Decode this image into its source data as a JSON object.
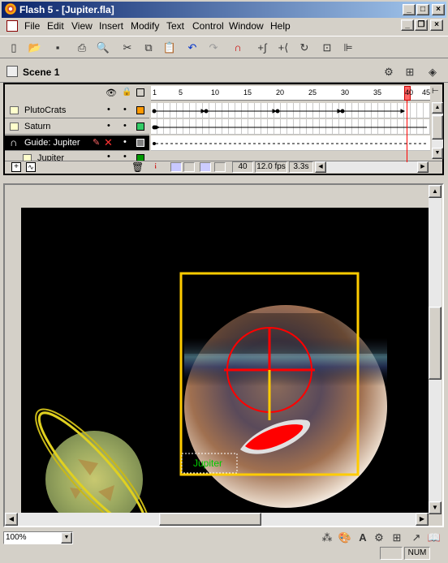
{
  "window": {
    "title": "Flash 5 - [Jupiter.fla]"
  },
  "menu": [
    "File",
    "Edit",
    "View",
    "Insert",
    "Modify",
    "Text",
    "Control",
    "Window",
    "Help"
  ],
  "scene": {
    "label": "Scene 1"
  },
  "timeline": {
    "ruler": [
      "1",
      "5",
      "10",
      "15",
      "20",
      "25",
      "30",
      "35",
      "40",
      "45"
    ],
    "layers": [
      {
        "name": "PlutoCrats",
        "color": "#ff9900"
      },
      {
        "name": "Saturn",
        "color": "#33cc66"
      },
      {
        "name": "Guide: Jupiter",
        "color": "#808080"
      },
      {
        "name": "Jupiter",
        "color": "#009900"
      }
    ],
    "current_frame": "40",
    "fps": "12.0 fps",
    "elapsed": "3.3s"
  },
  "stage": {
    "label_jupiter": "Jupiter"
  },
  "status": {
    "zoom": "100%",
    "num": "NUM"
  },
  "colors": {
    "title_start": "#0a246a",
    "title_end": "#a6caf0",
    "stage_bg": "#000000",
    "guide": "#ffcc00",
    "crosshair": "#ff0000",
    "label": "#00cc00"
  }
}
